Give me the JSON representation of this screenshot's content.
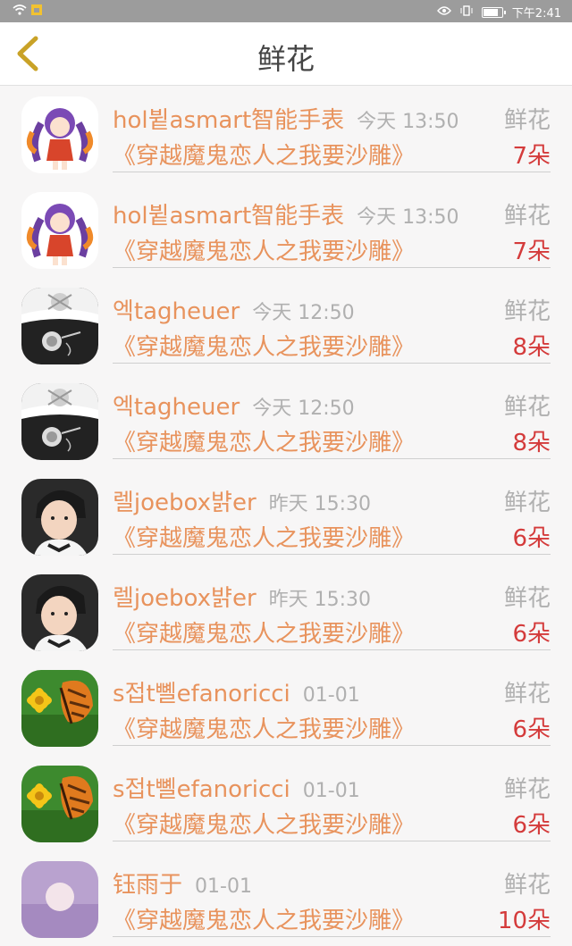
{
  "status_bar": {
    "left_icons": [
      "wifi-icon",
      "sim-icon"
    ],
    "right_icons": [
      "eye-icon",
      "vibrate-icon",
      "battery-icon"
    ],
    "battery_level": 0.8,
    "time": "下午2:41"
  },
  "header": {
    "title": "鲜花",
    "back_icon": "chevron-left-icon"
  },
  "colors": {
    "name": "#e8935d",
    "count": "#d43b3b",
    "muted": "#b0b0b0",
    "back": "#c9a227"
  },
  "items": [
    {
      "avatar": "anime-girl",
      "name": "hol뷭asmart智能手表",
      "time": "今天 13:50",
      "label": "鲜花",
      "book": "《穿越魔鬼恋人之我要沙雕》",
      "count": "7朵"
    },
    {
      "avatar": "anime-girl",
      "name": "hol뷭asmart智能手表",
      "time": "今天 13:50",
      "label": "鲜花",
      "book": "《穿越魔鬼恋人之我要沙雕》",
      "count": "7朵"
    },
    {
      "avatar": "puppet",
      "name": "엑tagheuer",
      "time": "今天 12:50",
      "label": "鲜花",
      "book": "《穿越魔鬼恋人之我要沙雕》",
      "count": "8朵"
    },
    {
      "avatar": "puppet",
      "name": "엑tagheuer",
      "time": "今天 12:50",
      "label": "鲜花",
      "book": "《穿越魔鬼恋人之我要沙雕》",
      "count": "8朵"
    },
    {
      "avatar": "boy",
      "name": "렐joebox뱕er",
      "time": "昨天 15:30",
      "label": "鲜花",
      "book": "《穿越魔鬼恋人之我要沙雕》",
      "count": "6朵"
    },
    {
      "avatar": "boy",
      "name": "렐joebox뱕er",
      "time": "昨天 15:30",
      "label": "鲜花",
      "book": "《穿越魔鬼恋人之我要沙雕》",
      "count": "6朵"
    },
    {
      "avatar": "butterfly",
      "name": "s접t뼬efanoricci",
      "time": "01-01",
      "label": "鲜花",
      "book": "《穿越魔鬼恋人之我要沙雕》",
      "count": "6朵"
    },
    {
      "avatar": "butterfly",
      "name": "s접t뼬efanoricci",
      "time": "01-01",
      "label": "鲜花",
      "book": "《穿越魔鬼恋人之我要沙雕》",
      "count": "6朵"
    },
    {
      "avatar": "moon",
      "name": "钰雨于",
      "time": "01-01",
      "label": "鲜花",
      "book": "《穿越魔鬼恋人之我要沙雕》",
      "count": "10朵"
    }
  ]
}
